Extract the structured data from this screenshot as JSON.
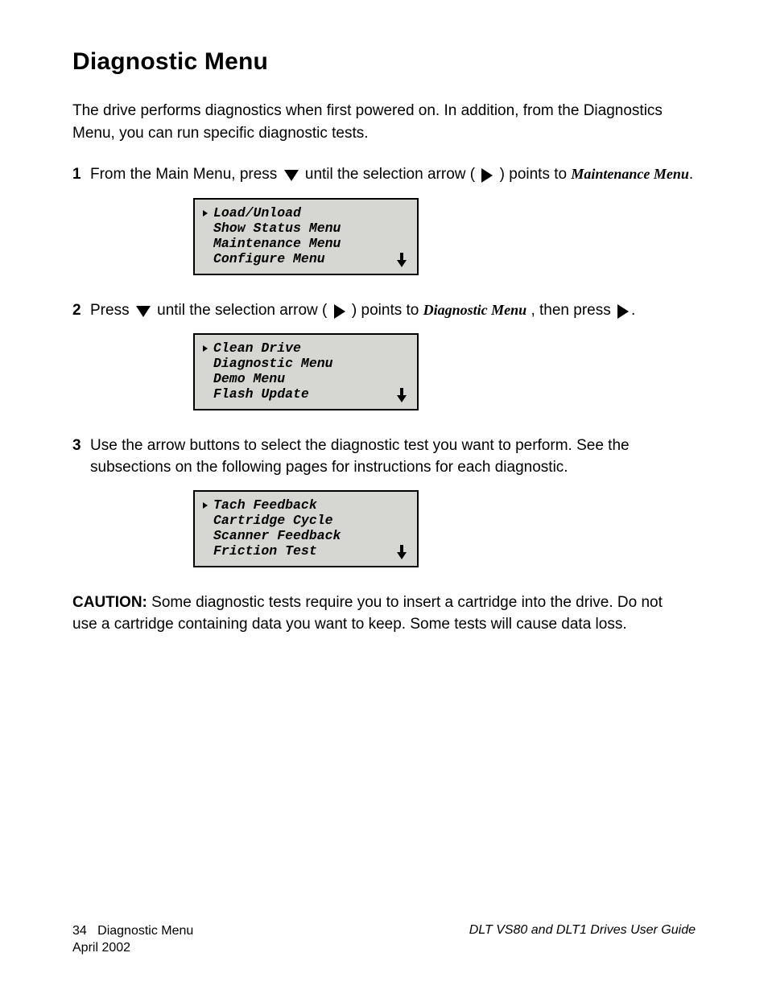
{
  "heading": "Diagnostic Menu",
  "intro": "The drive performs diagnostics when first powered on. In addition, from the Diagnostics Menu, you can run specific diagnostic tests.",
  "steps": {
    "step1_num": "1",
    "step1_text_pre": "From the Main Menu, press ",
    "step1_text_mid": " until the selection arrow (",
    "step1_text_post": ") points to ",
    "step1_target": "Maintenance Menu",
    "panel1": {
      "line1": "Load/Unload",
      "line2": "Show Status Menu",
      "line3": "Maintenance Menu",
      "line4": "Configure Menu"
    },
    "step2_num": "2",
    "step2_text_pre": "Press ",
    "step2_text_mid": " until the selection arrow (",
    "step2_text_points": ") points to ",
    "step2_target": "Diagnostic Menu",
    "step2_then_press": ", then press ",
    "panel2": {
      "line1": "Clean Drive",
      "line2": "Diagnostic Menu",
      "line3": "Demo Menu",
      "line4": "Flash Update"
    },
    "step3_num": "3",
    "step3_text_pre": "Use the arrow buttons to select the diagnostic test you want to perform. See the subsections on the following pages for instructions for each diagnostic.",
    "panel3": {
      "line1": "Tach Feedback",
      "line2": "Cartridge Cycle",
      "line3": "Scanner Feedback",
      "line4": "Friction Test"
    }
  },
  "caution_label": "CAUTION:",
  "caution_text": "Some diagnostic tests require you to insert a cartridge into the drive. Do not use a cartridge containing data you want to keep. Some tests will cause data loss.",
  "footer": {
    "page": "34",
    "line1": "Diagnostic Menu",
    "line2": "April 2002",
    "right": "DLT VS80 and DLT1 Drives User Guide"
  }
}
